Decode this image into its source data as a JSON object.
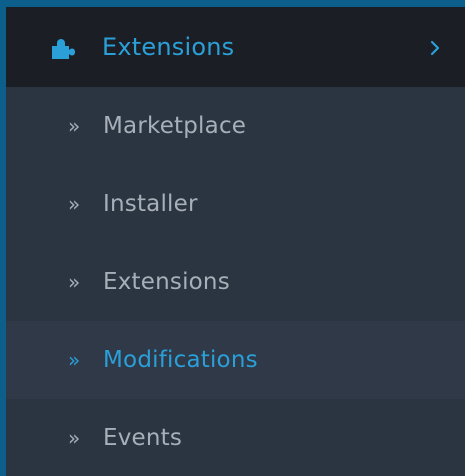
{
  "colors": {
    "page_border": "#0b5f8a",
    "header_bg": "#1b1f25",
    "menu_bg": "#2b3441",
    "active_item_bg": "#2f3947",
    "accent": "#2b9fd8",
    "muted_text": "#a7afb8"
  },
  "menu": {
    "header": {
      "label": "Extensions",
      "icon": "puzzle-piece-icon",
      "chevron_icon": "chevron-right-icon"
    },
    "items": [
      {
        "label": "Marketplace",
        "bullet": "»",
        "active": false
      },
      {
        "label": "Installer",
        "bullet": "»",
        "active": false
      },
      {
        "label": "Extensions",
        "bullet": "»",
        "active": false
      },
      {
        "label": "Modifications",
        "bullet": "»",
        "active": true
      },
      {
        "label": "Events",
        "bullet": "»",
        "active": false
      }
    ]
  }
}
